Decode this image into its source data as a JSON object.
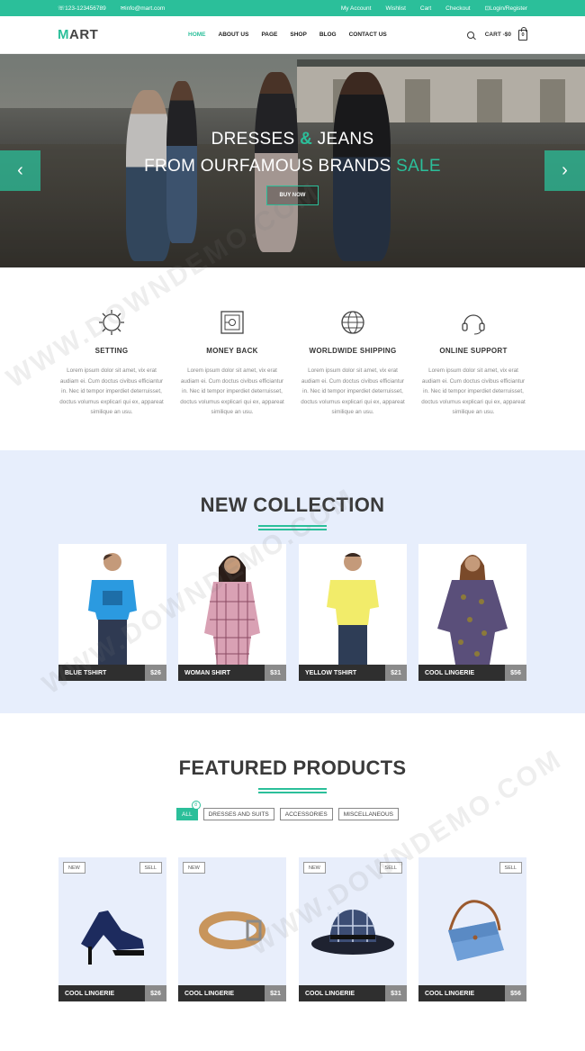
{
  "topbar": {
    "phone": "123-123456789",
    "email": "info@mart.com",
    "links": [
      "My Account",
      "Wishlist",
      "Cart",
      "Checkout",
      "Login/Register"
    ]
  },
  "header": {
    "logo_first": "M",
    "logo_rest": "ART",
    "nav": [
      "HOME",
      "ABOUT US",
      "PAGE",
      "SHOP",
      "BLOG",
      "CONTACT US"
    ],
    "cart_label": "CART -$0",
    "cart_count": "0"
  },
  "hero": {
    "line1_a": "DRESSES ",
    "line1_amp": "&",
    "line1_b": " JEANS",
    "line2_a": "FROM OURFAMOUS BRANDS ",
    "line2_b": "SALE",
    "button": "BUY NOW",
    "prev": "‹",
    "next": "›"
  },
  "features": [
    {
      "icon": "gear-icon",
      "title": "SETTING",
      "desc": "Lorem ipsum dolor sit amet, vix erat audiam ei. Cum doctus civibus efficiantur in. Nec id tempor imperdiet deterruisset, doctus volumus explicari qui ex, appareat similique an usu."
    },
    {
      "icon": "safe-icon",
      "title": "MONEY BACK",
      "desc": "Lorem ipsum dolor sit amet, vix erat audiam ei. Cum doctus civibus efficiantur in. Nec id tempor imperdiet deterruisset, doctus volumus explicari qui ex, appareat similique an usu."
    },
    {
      "icon": "globe-icon",
      "title": "WORLDWIDE SHIPPING",
      "desc": "Lorem ipsum dolor sit amet, vix erat audiam ei. Cum doctus civibus efficiantur in. Nec id tempor imperdiet deterruisset, doctus volumus explicari qui ex, appareat similique an usu."
    },
    {
      "icon": "headset-icon",
      "title": "ONLINE SUPPORT",
      "desc": "Lorem ipsum dolor sit amet, vix erat audiam ei. Cum doctus civibus efficiantur in. Nec id tempor imperdiet deterruisset, doctus volumus explicari qui ex, appareat similique an usu."
    }
  ],
  "collection": {
    "title": "NEW COLLECTION",
    "items": [
      {
        "name": "BLUE TSHIRT",
        "price": "$26"
      },
      {
        "name": "WOMAN SHIRT",
        "price": "$31"
      },
      {
        "name": "YELLOW TSHIRT",
        "price": "$21"
      },
      {
        "name": "COOL LINGERIE",
        "price": "$56"
      }
    ]
  },
  "featured": {
    "title": "FEATURED PRODUCTS",
    "filters": [
      "ALL",
      "DRESSES AND SUITS",
      "ACCESSORIES",
      "MISCELLANEOUS"
    ],
    "all_count": "8",
    "new_tag": "NEW",
    "sell_tag": "SELL",
    "items": [
      {
        "name": "COOL LINGERIE",
        "price": "$26"
      },
      {
        "name": "COOL LINGERIE",
        "price": "$21"
      },
      {
        "name": "COOL LINGERIE",
        "price": "$31"
      },
      {
        "name": "COOL LINGERIE",
        "price": "$56"
      }
    ]
  },
  "watermark": "WWW.DOWNDEMO.COM",
  "colors": {
    "accent": "#2bbf9a",
    "collection_bg": "#e7eefc",
    "label_bg": "#2f2f2f",
    "price_bg": "#8a8a8a"
  }
}
